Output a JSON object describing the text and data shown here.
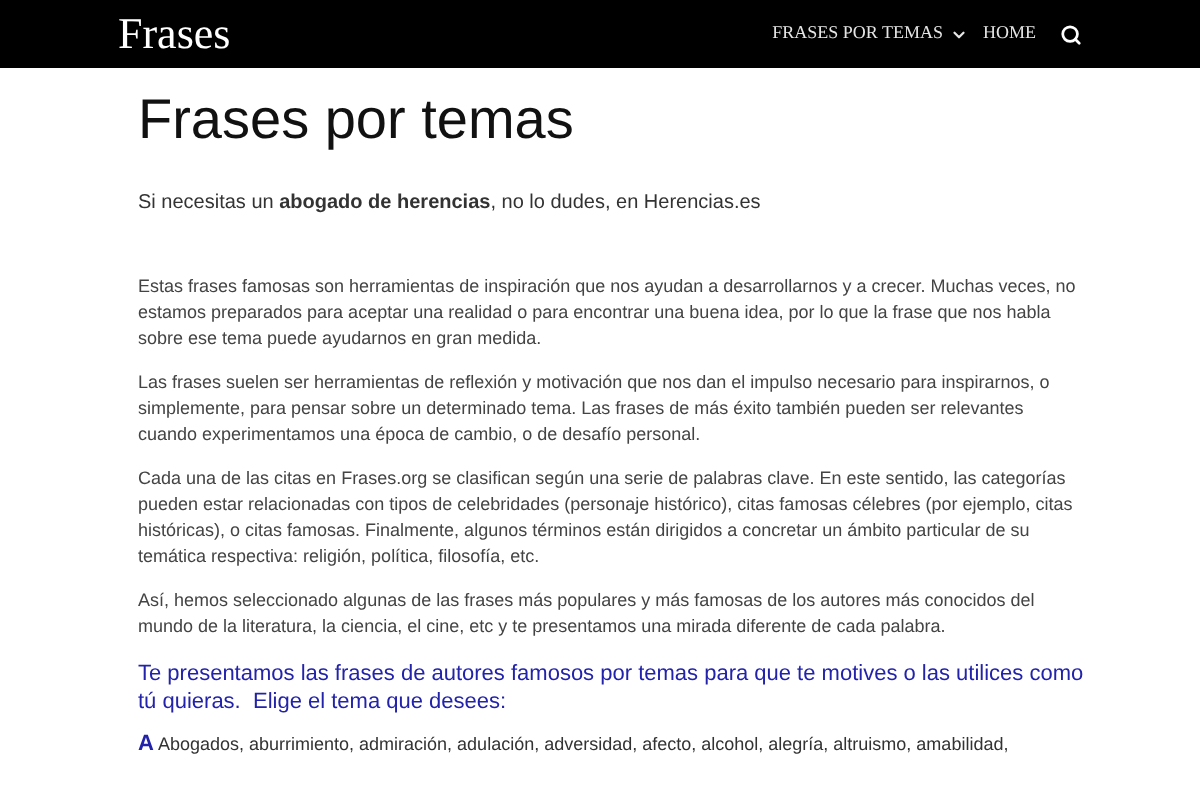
{
  "header": {
    "logo": "Frases",
    "nav": [
      {
        "label": "FRASES POR TEMAS",
        "dropdown": true
      },
      {
        "label": "HOME",
        "dropdown": false
      }
    ]
  },
  "title": "Frases por temas",
  "promo": "Si necesitas un **abogado de herencias**, no lo dudes, en Herencias.es",
  "paragraphs": [
    "Estas frases famosas son herramientas de inspiración que nos ayudan a desarrollarnos y a crecer. Muchas veces, no estamos preparados para aceptar una realidad o para encontrar una buena idea, por lo que la frase que nos habla sobre ese tema puede ayudarnos en gran medida.",
    "Las frases suelen ser herramientas de reflexión y motivación que nos dan el impulso necesario para inspirarnos, o simplemente, para pensar sobre un determinado tema. Las frases de más éxito también pueden ser relevantes cuando experimentamos una época de cambio, o de desafío personal.",
    "Cada una de las citas en Frases.org se clasifican según una serie de palabras clave. En este sentido, las categorías pueden estar relacionadas con tipos de celebridades (personaje histórico), citas famosas célebres (por ejemplo, citas históricas), o citas famosas. Finalmente, algunos términos están dirigidos a concretar un ámbito particular de su temática respectiva: religión, política, filosofía, etc.",
    "Así, hemos seleccionado algunas de las frases más populares y más famosas de los autores más conocidos del mundo de la literatura, la ciencia, el cine, etc y te presentamos una mirada diferente de cada palabra."
  ],
  "subheading": "Te presentamos las frases de autores famosos por temas para que te motives o las utilices como tú quieras.  Elige el tema que desees:",
  "topics": {
    "letter": "A",
    "text": "Abogados, aburrimiento, admiración, adulación, adversidad, afecto, alcohol, alegría, altruismo, amabilidad,"
  }
}
